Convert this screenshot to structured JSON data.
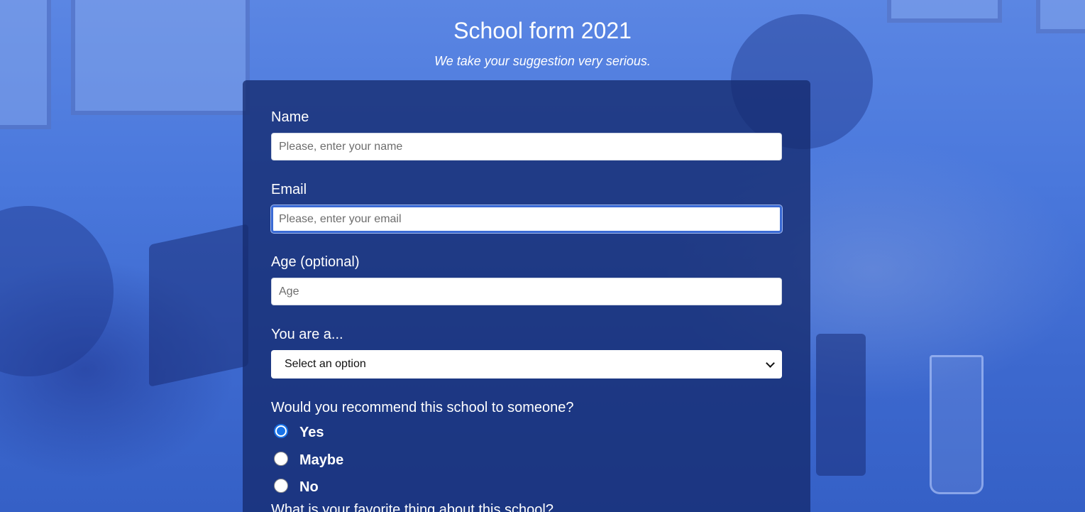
{
  "header": {
    "title": "School form 2021",
    "subtitle": "We take your suggestion very serious."
  },
  "form": {
    "name": {
      "label": "Name",
      "placeholder": "Please, enter your name",
      "value": ""
    },
    "email": {
      "label": "Email",
      "placeholder": "Please, enter your email",
      "value": "",
      "focused": true
    },
    "age": {
      "label": "Age (optional)",
      "placeholder": "Age",
      "value": ""
    },
    "role": {
      "label": "You are a...",
      "selected": "Select an option"
    },
    "recommend": {
      "label": "Would you recommend this school to someone?",
      "options": [
        {
          "label": "Yes",
          "checked": true
        },
        {
          "label": "Maybe",
          "checked": false
        },
        {
          "label": "No",
          "checked": false
        }
      ]
    },
    "favorite": {
      "label": "What is your favorite thing about this school?"
    }
  },
  "colors": {
    "background": "#3f6fd6",
    "card": "#142a6e",
    "focus_ring": "#3a6ad4",
    "radio_accent": "#1a73e8"
  }
}
